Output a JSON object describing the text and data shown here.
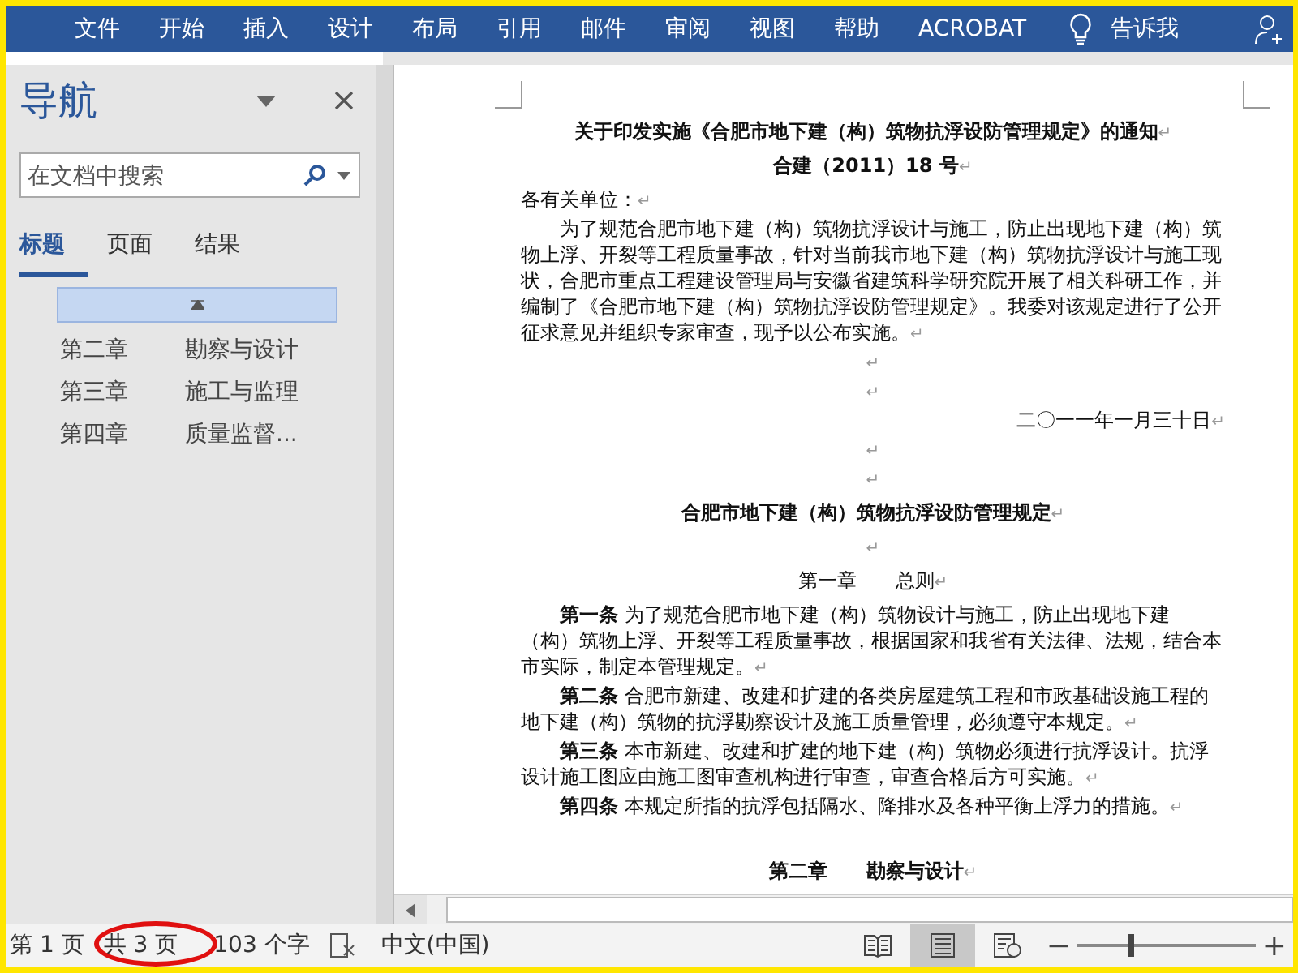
{
  "ribbon": {
    "tabs": [
      {
        "label": "文件",
        "selected": false
      },
      {
        "label": "开始",
        "selected": false
      },
      {
        "label": "插入",
        "selected": false
      },
      {
        "label": "设计",
        "selected": false
      },
      {
        "label": "布局",
        "selected": false
      },
      {
        "label": "引用",
        "selected": false
      },
      {
        "label": "邮件",
        "selected": false
      },
      {
        "label": "审阅",
        "selected": false
      },
      {
        "label": "视图",
        "selected": false
      },
      {
        "label": "帮助",
        "selected": false
      },
      {
        "label": "ACROBAT",
        "selected": false
      }
    ],
    "tell_me": "告诉我"
  },
  "navigation": {
    "title": "导航",
    "search": {
      "placeholder": "在文档中搜索"
    },
    "tabs": [
      {
        "label": "标题",
        "selected": true
      },
      {
        "label": "页面",
        "selected": false
      },
      {
        "label": "结果",
        "selected": false
      }
    ],
    "current_heading": {
      "expanded": true
    },
    "headings": [
      {
        "number": "第二章",
        "title": "勘察与设计"
      },
      {
        "number": "第三章",
        "title": "施工与监理"
      },
      {
        "number": "第四章",
        "title": "质量监督..."
      }
    ]
  },
  "document": {
    "paragraphs": [
      {
        "kind": "title",
        "text": "关于印发实施《合肥市地下建（构）筑物抗浮设防管理规定》的通知",
        "mark": "↵"
      },
      {
        "kind": "title",
        "text": "合建（2011）18 号",
        "mark": "↵"
      },
      {
        "kind": "plain",
        "text": "各有关单位：",
        "mark": "↵"
      },
      {
        "kind": "body",
        "text": "为了规范合肥市地下建（构）筑物抗浮设计与施工，防止出现地下建（构）筑物上浮、开裂等工程质量事故，针对当前我市地下建（构）筑物抗浮设计与施工现状，合肥市重点工程建设管理局与安徽省建筑科学研究院开展了相关科研工作，并编制了《合肥市地下建（构）筑物抗浮设防管理规定》。我委对该规定进行了公开征求意见并组织专家审查，现予以公布实施。",
        "mark": "↵"
      },
      {
        "kind": "blank",
        "mark": "↵"
      },
      {
        "kind": "blank",
        "mark": "↵"
      },
      {
        "kind": "right",
        "text": "二〇一一年一月三十日",
        "mark": "↵"
      },
      {
        "kind": "blank",
        "mark": "↵"
      },
      {
        "kind": "blank",
        "mark": "↵"
      },
      {
        "kind": "title",
        "text": "合肥市地下建（构）筑物抗浮设防管理规定",
        "mark": "↵"
      },
      {
        "kind": "blank",
        "mark": "↵"
      },
      {
        "kind": "center",
        "text": "第一章　　总则",
        "mark": "↵"
      },
      {
        "kind": "body",
        "text": "**第一条** 为了规范合肥市地下建（构）筑物设计与施工，防止出现地下建（构）筑物上浮、开裂等工程质量事故，根据国家和我省有关法律、法规，结合本市实际，制定本管理规定。",
        "mark": "↵"
      },
      {
        "kind": "body",
        "text": "**第二条** 合肥市新建、改建和扩建的各类房屋建筑工程和市政基础设施工程的地下建（构）筑物的抗浮勘察设计及施工质量管理，必须遵守本规定。",
        "mark": "↵"
      },
      {
        "kind": "body",
        "text": "**第三条** 本市新建、改建和扩建的地下建（构）筑物必须进行抗浮设计。抗浮设计施工图应由施工图审查机构进行审查，审查合格后方可实施。",
        "mark": "↵"
      },
      {
        "kind": "body",
        "text": "**第四条** 本规定所指的抗浮包括隔水、降排水及各种平衡上浮力的措施。",
        "mark": "↵"
      },
      {
        "kind": "chapter",
        "text": "第二章　　勘察与设计",
        "mark": "↵"
      }
    ]
  },
  "status_bar": {
    "page": "第 1 页",
    "total": "共 3 页",
    "words": "103 个字",
    "language": "中文(中国)",
    "views": [
      {
        "kind": "read",
        "selected": false
      },
      {
        "kind": "print",
        "selected": true
      },
      {
        "kind": "web",
        "selected": false
      }
    ],
    "zoom": {
      "minus": "−",
      "plus": "+",
      "level": 0.3
    }
  }
}
